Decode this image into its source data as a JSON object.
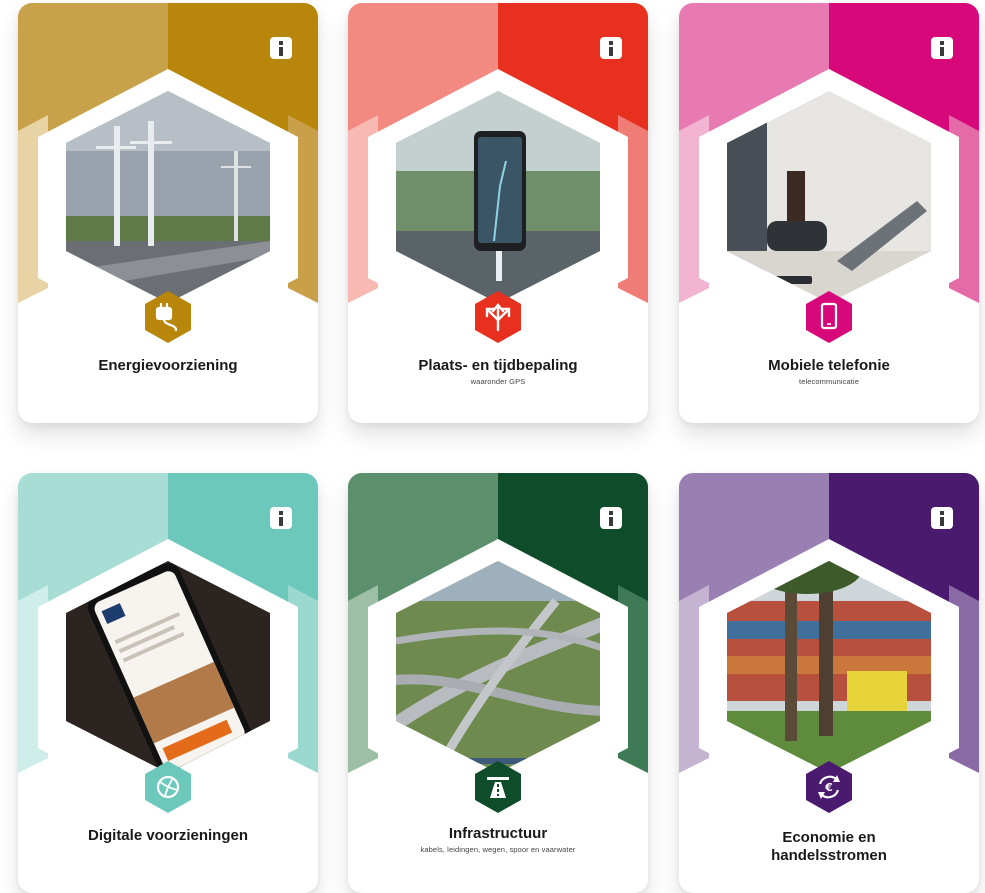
{
  "cards": [
    {
      "id": "energie",
      "title": "Energievoorziening",
      "subtitle": "",
      "icon": "electricity-plug-icon",
      "info_icon": "info-icon",
      "colors": {
        "dark": "#b8860b",
        "mid": "#c9a049",
        "light": "#e8d3a4",
        "top_left": "#c8a24a"
      },
      "photo": "power-lines-highway-photo"
    },
    {
      "id": "plaats",
      "title": "Plaats- en tijdbepaling",
      "subtitle": "waaronder GPS",
      "icon": "route-arrows-icon",
      "info_icon": "info-icon",
      "colors": {
        "dark": "#e8301f",
        "mid": "#f07c76",
        "light": "#f8b9b3",
        "top_left": "#f28a82"
      },
      "photo": "phone-gps-dashboard-photo"
    },
    {
      "id": "mobiel",
      "title": "Mobiele telefonie",
      "subtitle": "telecommunicatie",
      "icon": "smartphone-icon",
      "info_icon": "info-icon",
      "colors": {
        "dark": "#d6087a",
        "mid": "#e56aa8",
        "light": "#f3b4d2",
        "top_left": "#e779b3"
      },
      "photo": "laptop-working-photo"
    },
    {
      "id": "digitaal",
      "title": "Digitale voorzieningen",
      "subtitle": "",
      "icon": "globe-network-icon",
      "info_icon": "info-icon",
      "colors": {
        "dark": "#6dc8bc",
        "mid": "#9bd8cf",
        "light": "#cfeee9",
        "top_left": "#a8ddd6"
      },
      "photo": "smartphone-website-photo"
    },
    {
      "id": "infra",
      "title": "Infrastructuur",
      "subtitle": "kabels, leidingen, wegen, spoor en vaarwater",
      "icon": "highway-road-icon",
      "info_icon": "info-icon",
      "colors": {
        "dark": "#0f4d2a",
        "mid": "#3e7a55",
        "light": "#9dbfa6",
        "top_left": "#5c8f6c"
      },
      "photo": "highway-interchange-aerial-photo"
    },
    {
      "id": "economie",
      "title": "Economie en\nhandelsstromen",
      "subtitle": "",
      "icon": "euro-cycle-icon",
      "info_icon": "info-icon",
      "colors": {
        "dark": "#4a1a6e",
        "mid": "#8a6aa4",
        "light": "#c4b4d2",
        "top_left": "#9a80b2"
      },
      "photo": "shipping-containers-photo"
    }
  ]
}
